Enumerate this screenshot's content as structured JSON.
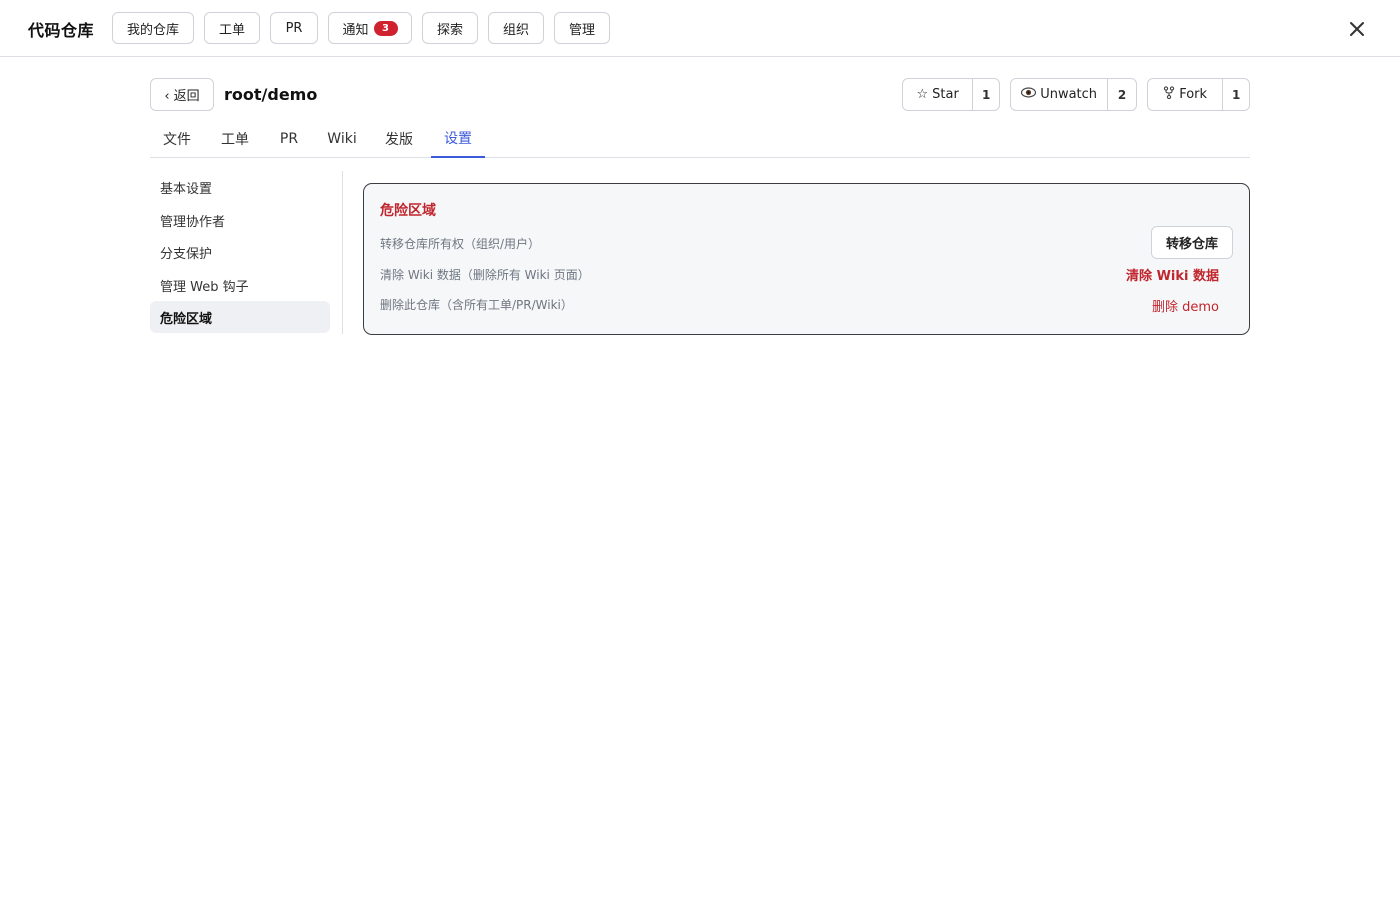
{
  "app": {
    "title": "代码仓库"
  },
  "topnav": {
    "items": [
      "我的仓库",
      "工单",
      "PR",
      "通知",
      "探索",
      "组织",
      "管理"
    ],
    "notification_count": "3"
  },
  "repo": {
    "back_label": "‹ 返回",
    "name": "root/demo",
    "star_label": "Star",
    "star_count": "1",
    "watch_label": "Unwatch",
    "watch_count": "2",
    "fork_label": "Fork",
    "fork_count": "1"
  },
  "tabs": [
    "文件",
    "工单",
    "PR",
    "Wiki",
    "发版",
    "设置"
  ],
  "active_tab": "设置",
  "side_menu": {
    "items": [
      "基本设置",
      "管理协作者",
      "分支保护",
      "管理 Web 钩子",
      "危险区域"
    ],
    "active": "危险区域"
  },
  "danger_zone": {
    "title": "危险区域",
    "transfer_desc": "转移仓库所有权（组织/用户）",
    "transfer_button": "转移仓库",
    "clear_wiki_desc": "清除 Wiki 数据（删除所有 Wiki 页面）",
    "clear_wiki_link": "清除 Wiki 数据",
    "delete_desc": "删除此仓库（含所有工单/PR/Wiki）",
    "delete_link": "删除 demo"
  },
  "colors": {
    "accent": "#3b5bdb",
    "danger": "#c0262d",
    "badge": "#cf222e"
  },
  "icons": {
    "star": "star-icon",
    "watch": "eye-icon",
    "fork": "fork-icon",
    "close": "close-icon"
  }
}
